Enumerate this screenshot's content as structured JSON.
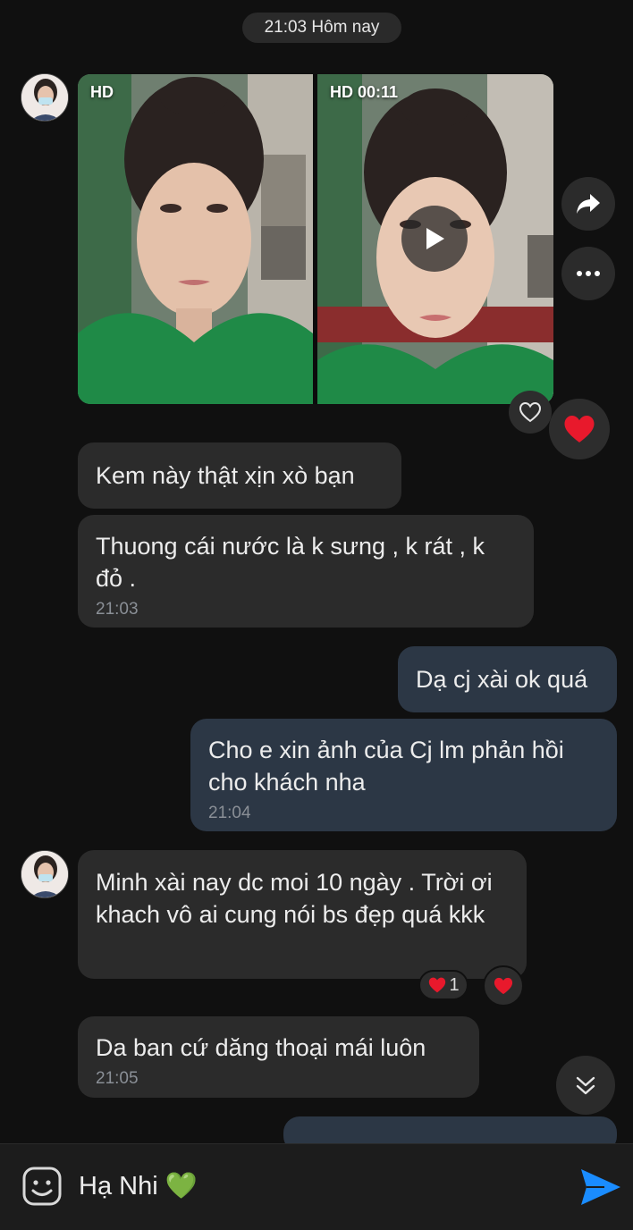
{
  "header": {
    "date_label": "21:03 Hôm nay"
  },
  "media": {
    "photo": {
      "badge": "HD"
    },
    "video": {
      "badge": "HD",
      "duration": "00:11"
    }
  },
  "messages": [
    {
      "direction": "in",
      "text": "Kem này thật xịn xò bạn",
      "time": ""
    },
    {
      "direction": "in",
      "text": "Thuong cái nước là k sưng , k rát , k đỏ .",
      "time": "21:03"
    },
    {
      "direction": "out",
      "text": "Dạ cj xài ok quá",
      "time": ""
    },
    {
      "direction": "out",
      "text": "Cho e xin ảnh của Cj lm phản hồi cho khách nha",
      "time": "21:04"
    },
    {
      "direction": "in",
      "text": "Minh xài nay dc moi 10 ngày . Trời ơi khach vô ai cung nói bs đẹp quá kkk",
      "time": ""
    },
    {
      "direction": "in",
      "text": "Da ban cứ dăng thoại mái luôn",
      "time": "21:05"
    }
  ],
  "reactions": {
    "message_5_count": "1"
  },
  "composer": {
    "input_value": "Hạ Nhi 💚"
  },
  "colors": {
    "background": "#101010",
    "incoming_bubble": "#2b2b2b",
    "outgoing_bubble": "#2c3745",
    "send_accent": "#1a8cff",
    "heart": "#e8192c"
  },
  "icons": [
    "share-icon",
    "more-icon",
    "play-icon",
    "heart-outline-icon",
    "heart-icon",
    "chevrons-down-icon",
    "sticker-icon",
    "send-icon"
  ]
}
